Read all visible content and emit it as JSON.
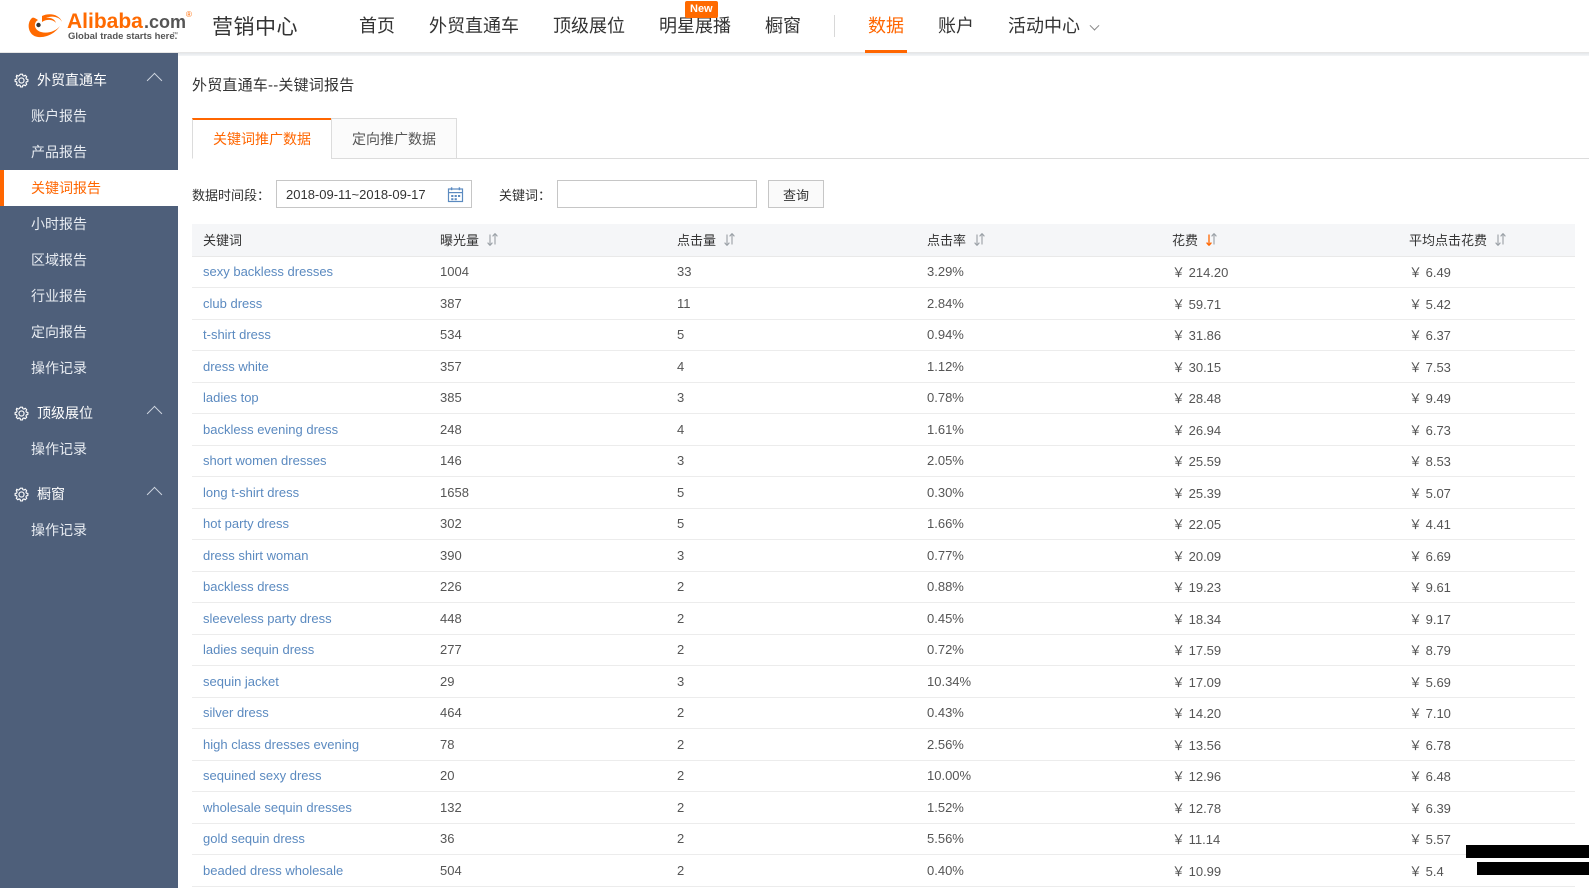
{
  "topnav": {
    "brand": "营销中心",
    "logo_alt": "Alibaba.com Global trade starts here.",
    "items": [
      {
        "label": "首页",
        "active": false,
        "badge": null
      },
      {
        "label": "外贸直通车",
        "active": false,
        "badge": null
      },
      {
        "label": "顶级展位",
        "active": false,
        "badge": null
      },
      {
        "label": "明星展播",
        "active": false,
        "badge": "New"
      },
      {
        "label": "橱窗",
        "active": false,
        "badge": null
      },
      {
        "label": "数据",
        "active": true,
        "badge": null
      },
      {
        "label": "账户",
        "active": false,
        "badge": null
      },
      {
        "label": "活动中心",
        "active": false,
        "badge": null,
        "caret": true
      }
    ]
  },
  "sidebar": {
    "groups": [
      {
        "label": "外贸直通车",
        "items": [
          {
            "label": "账户报告",
            "active": false
          },
          {
            "label": "产品报告",
            "active": false
          },
          {
            "label": "关键词报告",
            "active": true
          },
          {
            "label": "小时报告",
            "active": false
          },
          {
            "label": "区域报告",
            "active": false
          },
          {
            "label": "行业报告",
            "active": false
          },
          {
            "label": "定向报告",
            "active": false
          },
          {
            "label": "操作记录",
            "active": false
          }
        ]
      },
      {
        "label": "顶级展位",
        "items": [
          {
            "label": "操作记录",
            "active": false
          }
        ]
      },
      {
        "label": "橱窗",
        "items": [
          {
            "label": "操作记录",
            "active": false
          }
        ]
      }
    ]
  },
  "page": {
    "title": "外贸直通车--关键词报告",
    "tabs": [
      {
        "label": "关键词推广数据",
        "active": true
      },
      {
        "label": "定向推广数据",
        "active": false
      }
    ],
    "filter": {
      "date_label": "数据时间段：",
      "date_value": "2018-09-11~2018-09-17",
      "keyword_label": "关键词：",
      "keyword_value": "",
      "keyword_placeholder": "",
      "query_button": "查询"
    }
  },
  "table": {
    "columns": [
      {
        "key": "keyword",
        "label": "关键词",
        "sortable": false,
        "sort": "none"
      },
      {
        "key": "impressions",
        "label": "曝光量",
        "sortable": true,
        "sort": "none"
      },
      {
        "key": "clicks",
        "label": "点击量",
        "sortable": true,
        "sort": "none"
      },
      {
        "key": "ctr",
        "label": "点击率",
        "sortable": true,
        "sort": "none"
      },
      {
        "key": "cost",
        "label": "花费",
        "sortable": true,
        "sort": "desc"
      },
      {
        "key": "avg_cost",
        "label": "平均点击花费",
        "sortable": true,
        "sort": "none"
      }
    ],
    "rows": [
      {
        "keyword": "sexy backless dresses",
        "impressions": "1004",
        "clicks": "33",
        "ctr": "3.29%",
        "cost": "￥ 214.20",
        "avg_cost": "￥ 6.49"
      },
      {
        "keyword": "club dress",
        "impressions": "387",
        "clicks": "11",
        "ctr": "2.84%",
        "cost": "￥ 59.71",
        "avg_cost": "￥ 5.42"
      },
      {
        "keyword": "t-shirt dress",
        "impressions": "534",
        "clicks": "5",
        "ctr": "0.94%",
        "cost": "￥ 31.86",
        "avg_cost": "￥ 6.37"
      },
      {
        "keyword": "dress white",
        "impressions": "357",
        "clicks": "4",
        "ctr": "1.12%",
        "cost": "￥ 30.15",
        "avg_cost": "￥ 7.53"
      },
      {
        "keyword": "ladies top",
        "impressions": "385",
        "clicks": "3",
        "ctr": "0.78%",
        "cost": "￥ 28.48",
        "avg_cost": "￥ 9.49"
      },
      {
        "keyword": "backless evening dress",
        "impressions": "248",
        "clicks": "4",
        "ctr": "1.61%",
        "cost": "￥ 26.94",
        "avg_cost": "￥ 6.73"
      },
      {
        "keyword": "short women dresses",
        "impressions": "146",
        "clicks": "3",
        "ctr": "2.05%",
        "cost": "￥ 25.59",
        "avg_cost": "￥ 8.53"
      },
      {
        "keyword": "long t-shirt dress",
        "impressions": "1658",
        "clicks": "5",
        "ctr": "0.30%",
        "cost": "￥ 25.39",
        "avg_cost": "￥ 5.07"
      },
      {
        "keyword": "hot party dress",
        "impressions": "302",
        "clicks": "5",
        "ctr": "1.66%",
        "cost": "￥ 22.05",
        "avg_cost": "￥ 4.41"
      },
      {
        "keyword": "dress shirt woman",
        "impressions": "390",
        "clicks": "3",
        "ctr": "0.77%",
        "cost": "￥ 20.09",
        "avg_cost": "￥ 6.69"
      },
      {
        "keyword": "backless dress",
        "impressions": "226",
        "clicks": "2",
        "ctr": "0.88%",
        "cost": "￥ 19.23",
        "avg_cost": "￥ 9.61"
      },
      {
        "keyword": "sleeveless party dress",
        "impressions": "448",
        "clicks": "2",
        "ctr": "0.45%",
        "cost": "￥ 18.34",
        "avg_cost": "￥ 9.17"
      },
      {
        "keyword": "ladies sequin dress",
        "impressions": "277",
        "clicks": "2",
        "ctr": "0.72%",
        "cost": "￥ 17.59",
        "avg_cost": "￥ 8.79"
      },
      {
        "keyword": "sequin jacket",
        "impressions": "29",
        "clicks": "3",
        "ctr": "10.34%",
        "cost": "￥ 17.09",
        "avg_cost": "￥ 5.69"
      },
      {
        "keyword": "silver dress",
        "impressions": "464",
        "clicks": "2",
        "ctr": "0.43%",
        "cost": "￥ 14.20",
        "avg_cost": "￥ 7.10"
      },
      {
        "keyword": "high class dresses evening",
        "impressions": "78",
        "clicks": "2",
        "ctr": "2.56%",
        "cost": "￥ 13.56",
        "avg_cost": "￥ 6.78"
      },
      {
        "keyword": "sequined sexy dress",
        "impressions": "20",
        "clicks": "2",
        "ctr": "10.00%",
        "cost": "￥ 12.96",
        "avg_cost": "￥ 6.48"
      },
      {
        "keyword": "wholesale sequin dresses",
        "impressions": "132",
        "clicks": "2",
        "ctr": "1.52%",
        "cost": "￥ 12.78",
        "avg_cost": "￥ 6.39"
      },
      {
        "keyword": "gold sequin dress",
        "impressions": "36",
        "clicks": "2",
        "ctr": "5.56%",
        "cost": "￥ 11.14",
        "avg_cost": "￥ 5.57"
      },
      {
        "keyword": "beaded dress wholesale",
        "impressions": "504",
        "clicks": "2",
        "ctr": "0.40%",
        "cost": "￥ 10.99",
        "avg_cost": "￥ 5.4"
      }
    ]
  },
  "colors": {
    "accent": "#ff6600",
    "sidebar_bg": "#4e5f7a",
    "link": "#5b8ac0",
    "header_bg": "#f5f6f8",
    "text": "#333333"
  }
}
